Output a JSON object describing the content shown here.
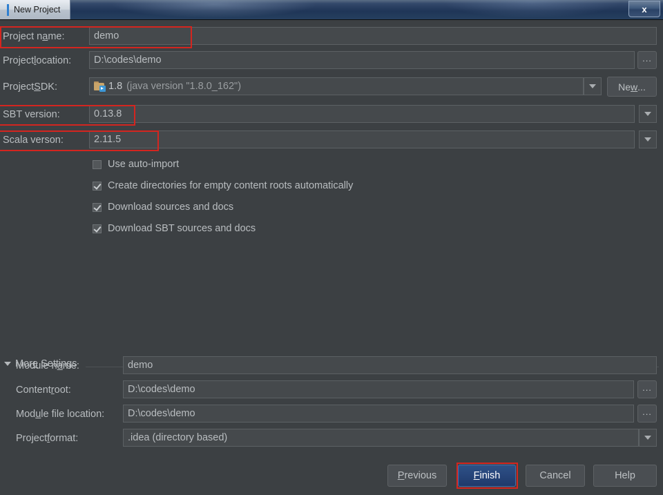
{
  "window": {
    "title": "New Project",
    "close_label": "x"
  },
  "form": {
    "fields": [
      {
        "label_pre": "Project n",
        "label_mnemonic": "a",
        "label_post": "me:",
        "value": "demo"
      },
      {
        "label_pre": "Project ",
        "label_mnemonic": "l",
        "label_post": "ocation:",
        "value": "D:\\codes\\demo"
      },
      {
        "label_pre": "Project ",
        "label_mnemonic": "S",
        "label_post": "DK:",
        "value": "1.8",
        "value_suffix": "(java version \"1.8.0_162\")"
      },
      {
        "label_pre": "SBT version:",
        "label_mnemonic": "",
        "label_post": "",
        "value": "0.13.8"
      },
      {
        "label_pre": "Scala verson:",
        "label_mnemonic": "",
        "label_post": "",
        "value": "2.11.5"
      }
    ],
    "browse_button_label": "...",
    "new_button_pre": "Ne",
    "new_button_mnemonic": "w",
    "new_button_post": "..."
  },
  "checkboxes": [
    {
      "label": "Use auto-import",
      "checked": false
    },
    {
      "label": "Create directories for empty content roots automatically",
      "checked": true
    },
    {
      "label": "Download sources and docs",
      "checked": true
    },
    {
      "label": "Download SBT sources and docs",
      "checked": true
    }
  ],
  "more_settings": {
    "label_pre": "Mor",
    "label_mnemonic": "e",
    "label_post": " Settings",
    "fields": [
      {
        "label_pre": "Module n",
        "label_mnemonic": "a",
        "label_post": "me:",
        "value": "demo"
      },
      {
        "label_pre": "Content ",
        "label_mnemonic": "r",
        "label_post": "oot:",
        "value": "D:\\codes\\demo"
      },
      {
        "label_pre": "Mod",
        "label_mnemonic": "u",
        "label_post": "le file location:",
        "value": "D:\\codes\\demo"
      },
      {
        "label_pre": "Project ",
        "label_mnemonic": "f",
        "label_post": "ormat:",
        "value": ".idea (directory based)"
      }
    ],
    "browse_button_label": "..."
  },
  "footer": {
    "previous_pre": "",
    "previous_mnemonic": "P",
    "previous_post": "revious",
    "finish_pre": "",
    "finish_mnemonic": "F",
    "finish_post": "inish",
    "cancel": "Cancel",
    "help": "Help"
  },
  "colors": {
    "background": "#3c4043",
    "field_background": "#45494c",
    "text": "#b9bdc0",
    "annotation": "#d5251f",
    "default_button": "#27457a",
    "titlebar": "#1f3557"
  }
}
